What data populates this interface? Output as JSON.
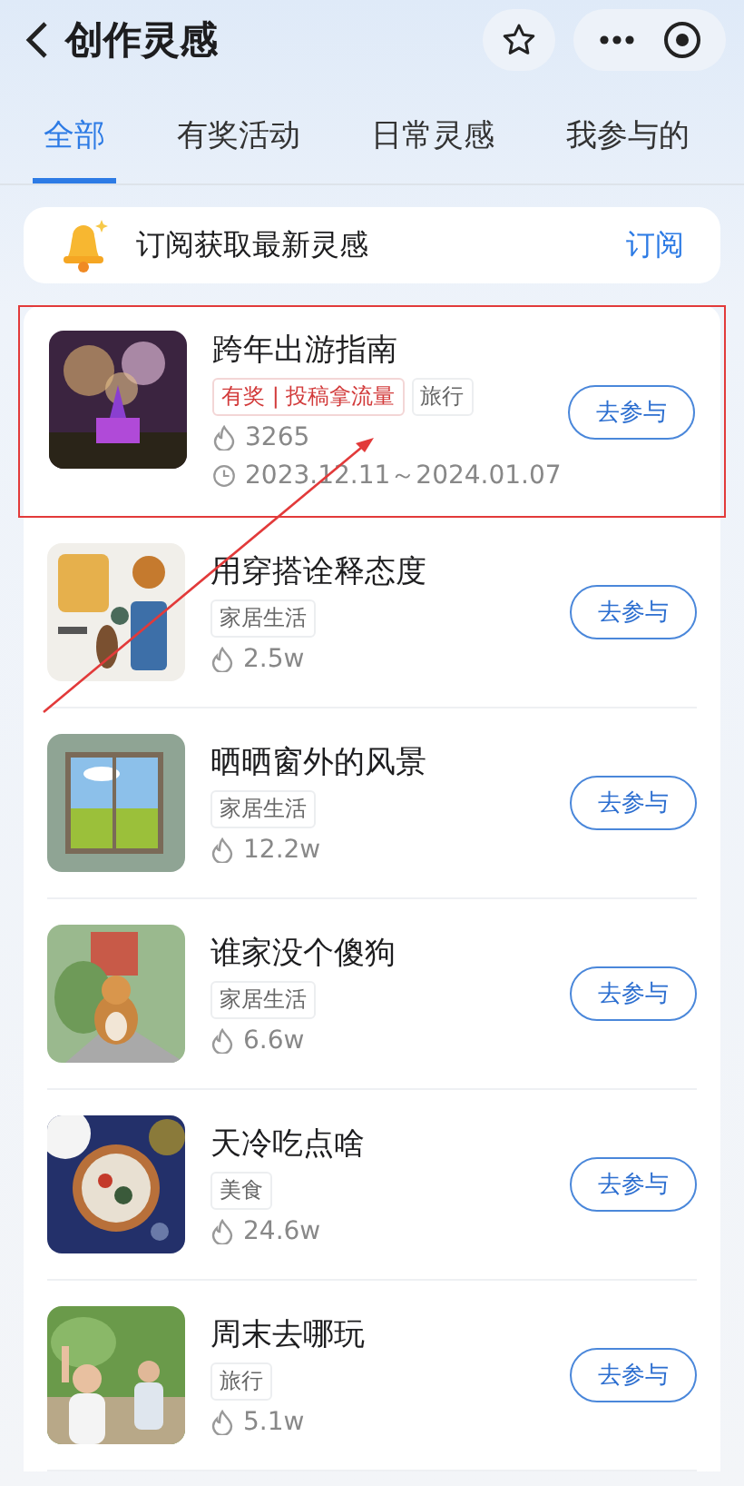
{
  "header": {
    "title": "创作灵感"
  },
  "tabs": [
    {
      "label": "全部",
      "selected": true
    },
    {
      "label": "有奖活动",
      "selected": false
    },
    {
      "label": "日常灵感",
      "selected": false
    },
    {
      "label": "我参与的",
      "selected": false
    }
  ],
  "subscribe_banner": {
    "text": "订阅获取最新灵感",
    "action": "订阅"
  },
  "topics": [
    {
      "title": "跨年出游指南",
      "tags": [
        {
          "label": "有奖 | 投稿拿流量",
          "kind": "reward"
        },
        {
          "label": "旅行",
          "kind": "category"
        }
      ],
      "heat": "3265",
      "period": "2023.12.11～2024.01.07",
      "button": "去参与",
      "highlighted": true
    },
    {
      "title": "用穿搭诠释态度",
      "tags": [
        {
          "label": "家居生活",
          "kind": "category"
        }
      ],
      "heat": "2.5w",
      "button": "去参与",
      "highlighted": false
    },
    {
      "title": "晒晒窗外的风景",
      "tags": [
        {
          "label": "家居生活",
          "kind": "category"
        }
      ],
      "heat": "12.2w",
      "button": "去参与",
      "highlighted": false
    },
    {
      "title": "谁家没个傻狗",
      "tags": [
        {
          "label": "家居生活",
          "kind": "category"
        }
      ],
      "heat": "6.6w",
      "button": "去参与",
      "highlighted": false
    },
    {
      "title": "天冷吃点啥",
      "tags": [
        {
          "label": "美食",
          "kind": "category"
        }
      ],
      "heat": "24.6w",
      "button": "去参与",
      "highlighted": false
    },
    {
      "title": "周末去哪玩",
      "tags": [
        {
          "label": "旅行",
          "kind": "category"
        }
      ],
      "heat": "5.1w",
      "button": "去参与",
      "highlighted": false
    }
  ]
}
